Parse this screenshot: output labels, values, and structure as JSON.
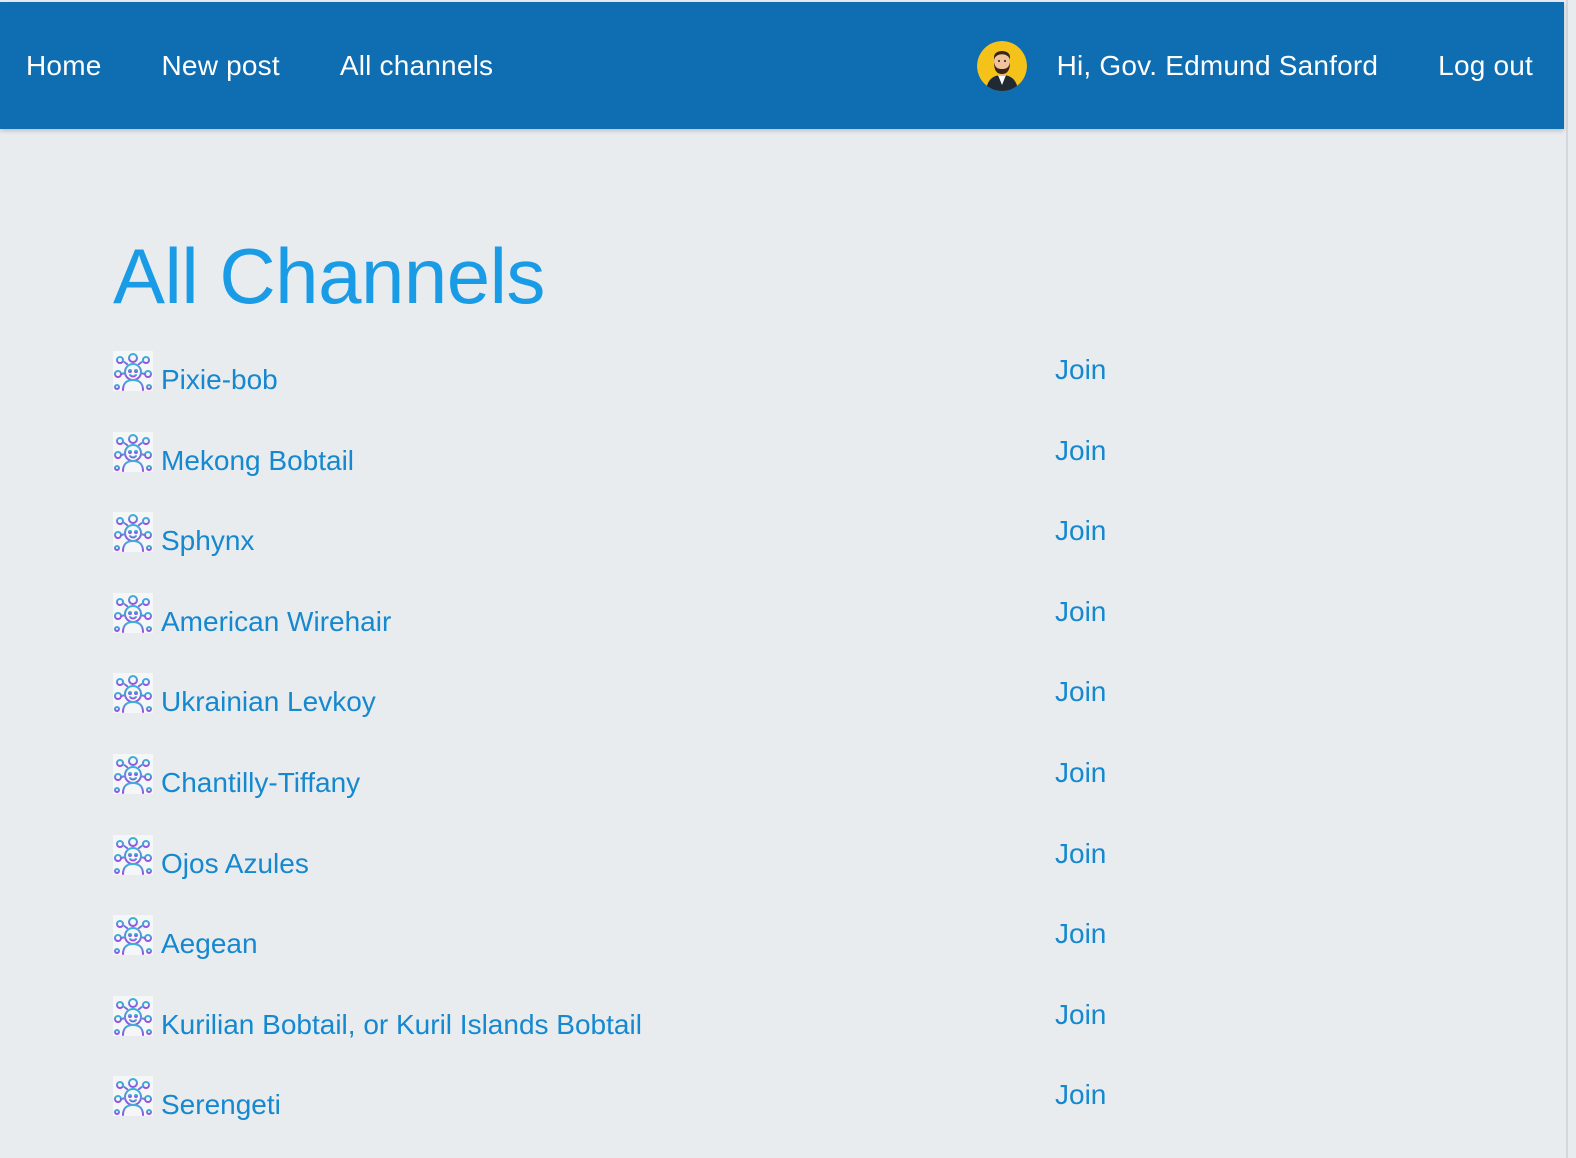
{
  "nav": {
    "home_label": "Home",
    "new_post_label": "New post",
    "all_channels_label": "All channels",
    "greeting": "Hi, Gov. Edmund Sanford",
    "logout_label": "Log out"
  },
  "colors": {
    "navbar": "#0f6db1",
    "title": "#1a9be6",
    "link": "#1588cf",
    "background": "#e8ecef"
  },
  "page": {
    "title": "All Channels"
  },
  "channels": [
    {
      "name": "Pixie-bob",
      "action": "Join",
      "icon": "channel-avatar-icon"
    },
    {
      "name": "Mekong Bobtail",
      "action": "Join",
      "icon": "channel-avatar-icon"
    },
    {
      "name": "Sphynx",
      "action": "Join",
      "icon": "channel-avatar-icon"
    },
    {
      "name": "American Wirehair",
      "action": "Join",
      "icon": "channel-avatar-icon"
    },
    {
      "name": "Ukrainian Levkoy",
      "action": "Join",
      "icon": "channel-avatar-icon"
    },
    {
      "name": "Chantilly-Tiffany",
      "action": "Join",
      "icon": "channel-avatar-icon"
    },
    {
      "name": "Ojos Azules",
      "action": "Join",
      "icon": "channel-avatar-icon"
    },
    {
      "name": "Aegean",
      "action": "Join",
      "icon": "channel-avatar-icon"
    },
    {
      "name": "Kurilian Bobtail, or Kuril Islands Bobtail",
      "action": "Join",
      "icon": "channel-avatar-icon"
    },
    {
      "name": "Serengeti",
      "action": "Join",
      "icon": "channel-avatar-icon"
    }
  ]
}
